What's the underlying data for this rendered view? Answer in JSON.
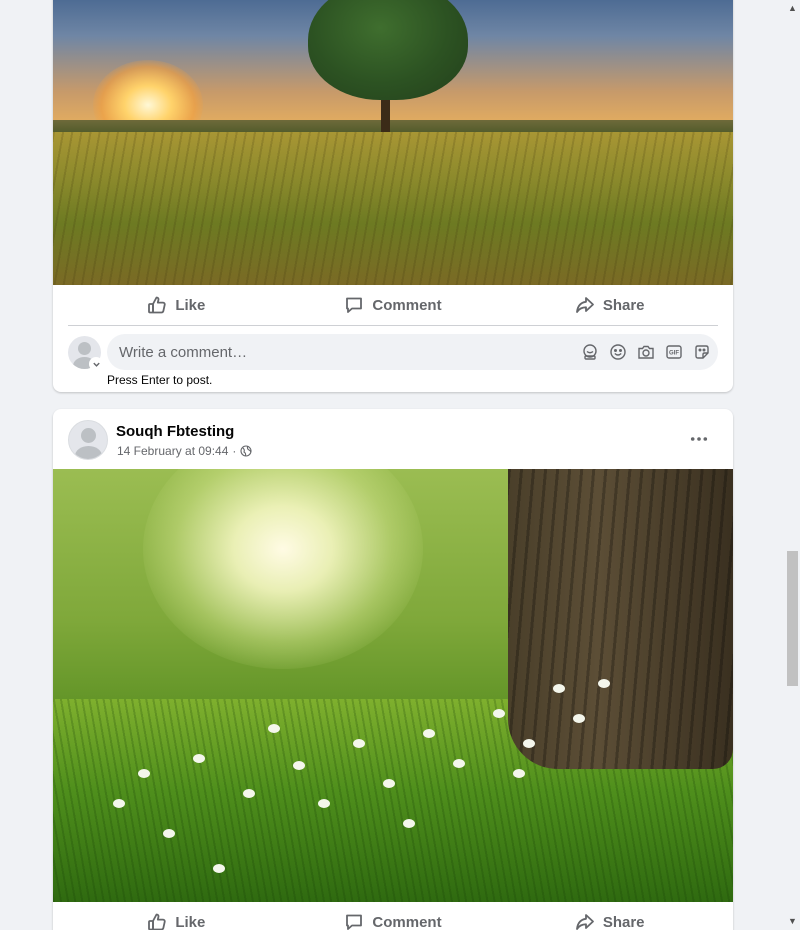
{
  "posts": [
    {
      "photo": "sunset-tree-field-photo",
      "actions": {
        "like": "Like",
        "comment": "Comment",
        "share": "Share"
      },
      "composer": {
        "placeholder": "Write a comment…",
        "hint": "Press Enter to post.",
        "icons": [
          "avatar-sticker-icon",
          "emoji-icon",
          "camera-icon",
          "gif-icon",
          "sticker-icon"
        ]
      }
    },
    {
      "author": "Souqh Fbtesting",
      "timestamp": "14 February at 09:44",
      "separator": "·",
      "privacy": "globe-icon",
      "more": "more-options-icon",
      "photo": "tree-trunk-meadow-flowers-photo",
      "actions": {
        "like": "Like",
        "comment": "Comment",
        "share": "Share"
      }
    }
  ],
  "colors": {
    "page_bg": "#f0f2f5",
    "card_bg": "#ffffff",
    "secondary_text": "#65676b",
    "primary_text": "#050505"
  }
}
